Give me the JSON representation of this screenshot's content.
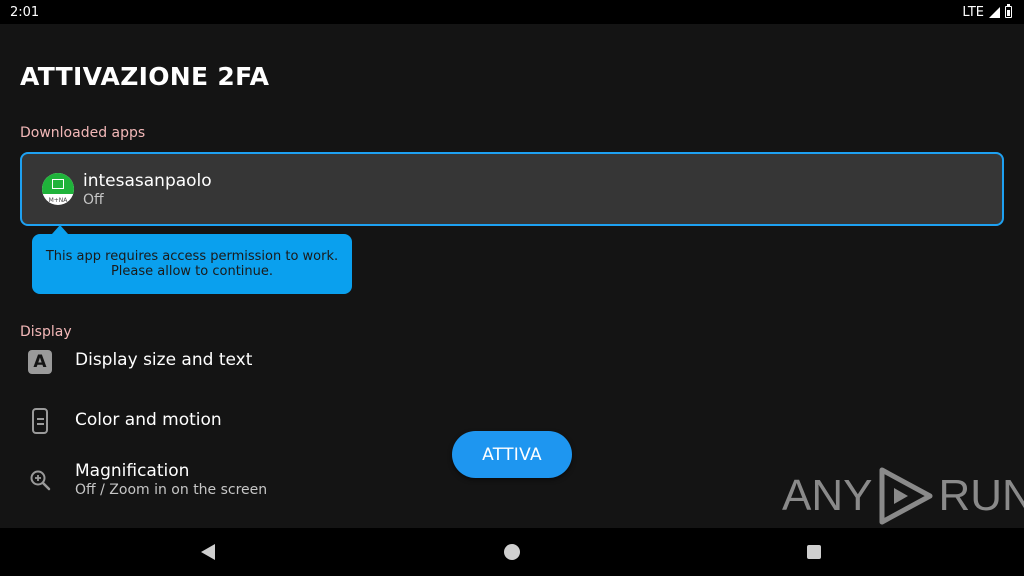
{
  "status_bar": {
    "time": "2:01",
    "network": "LTE"
  },
  "page": {
    "title": "ATTIVAZIONE 2FA"
  },
  "sections": {
    "downloaded": {
      "header": "Downloaded apps",
      "app": {
        "name": "intesasanpaolo",
        "status": "Off",
        "icon_caption": "M+NA"
      }
    },
    "tooltip": {
      "line1": "This app requires access permission to work.",
      "line2": "Please allow to continue."
    },
    "display": {
      "header": "Display",
      "items": [
        {
          "title": "Display size and text",
          "icon": "text-size-icon"
        },
        {
          "title": "Color and motion",
          "icon": "color-motion-icon"
        },
        {
          "title": "Magnification",
          "subtitle": "Off / Zoom in on the screen",
          "icon": "magnify-icon"
        }
      ]
    }
  },
  "action_button": {
    "label": "ATTIVA",
    "color": "#1e96f0"
  },
  "watermark": {
    "left": "ANY",
    "right": "RUN"
  },
  "accent_color": "#1ea1f2"
}
